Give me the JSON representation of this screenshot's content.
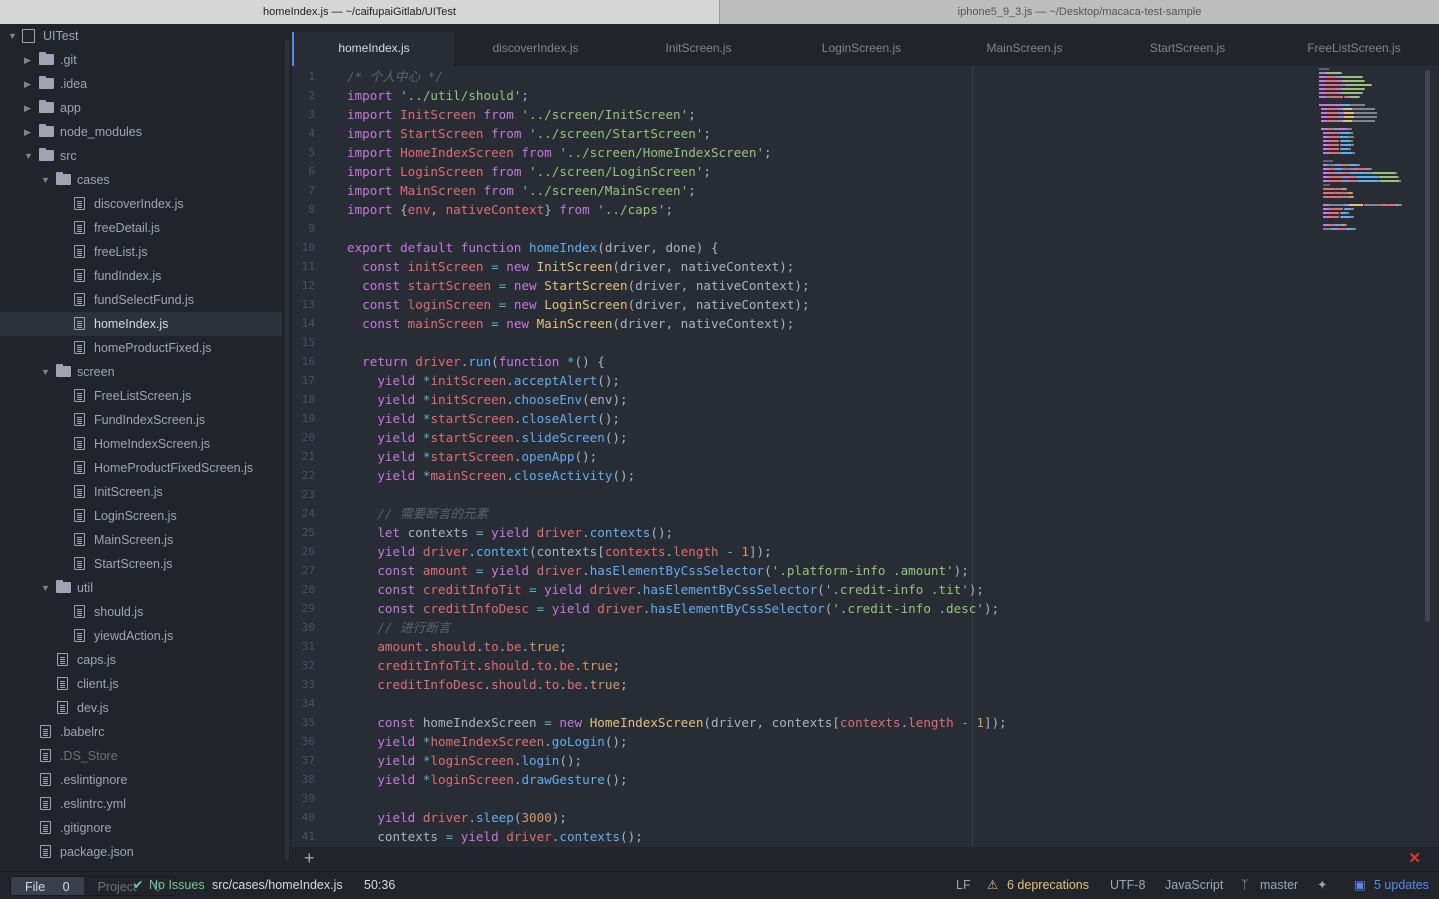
{
  "window_tabs": [
    {
      "title": "homeIndex.js — ~/caifupaiGitlab/UITest"
    },
    {
      "title": "iphone5_9_3.js — ~/Desktop/macaca-test-sample"
    }
  ],
  "tree": {
    "root": "UITest",
    "items": [
      {
        "label": ".git",
        "type": "folder",
        "depth": 1,
        "expanded": false
      },
      {
        "label": ".idea",
        "type": "folder",
        "depth": 1,
        "expanded": false
      },
      {
        "label": "app",
        "type": "folder",
        "depth": 1,
        "expanded": false
      },
      {
        "label": "node_modules",
        "type": "folder",
        "depth": 1,
        "expanded": false
      },
      {
        "label": "src",
        "type": "folder",
        "depth": 1,
        "expanded": true
      },
      {
        "label": "cases",
        "type": "folder",
        "depth": 2,
        "expanded": true
      },
      {
        "label": "discoverIndex.js",
        "type": "file",
        "depth": 3
      },
      {
        "label": "freeDetail.js",
        "type": "file",
        "depth": 3
      },
      {
        "label": "freeList.js",
        "type": "file",
        "depth": 3
      },
      {
        "label": "fundIndex.js",
        "type": "file",
        "depth": 3
      },
      {
        "label": "fundSelectFund.js",
        "type": "file",
        "depth": 3
      },
      {
        "label": "homeIndex.js",
        "type": "file",
        "depth": 3,
        "selected": true
      },
      {
        "label": "homeProductFixed.js",
        "type": "file",
        "depth": 3
      },
      {
        "label": "screen",
        "type": "folder",
        "depth": 2,
        "expanded": true
      },
      {
        "label": "FreeListScreen.js",
        "type": "file",
        "depth": 3
      },
      {
        "label": "FundIndexScreen.js",
        "type": "file",
        "depth": 3
      },
      {
        "label": "HomeIndexScreen.js",
        "type": "file",
        "depth": 3
      },
      {
        "label": "HomeProductFixedScreen.js",
        "type": "file",
        "depth": 3
      },
      {
        "label": "InitScreen.js",
        "type": "file",
        "depth": 3
      },
      {
        "label": "LoginScreen.js",
        "type": "file",
        "depth": 3
      },
      {
        "label": "MainScreen.js",
        "type": "file",
        "depth": 3
      },
      {
        "label": "StartScreen.js",
        "type": "file",
        "depth": 3
      },
      {
        "label": "util",
        "type": "folder",
        "depth": 2,
        "expanded": true
      },
      {
        "label": "should.js",
        "type": "file",
        "depth": 3
      },
      {
        "label": "yiewdAction.js",
        "type": "file",
        "depth": 3
      },
      {
        "label": "caps.js",
        "type": "file",
        "depth": 2
      },
      {
        "label": "client.js",
        "type": "file",
        "depth": 2
      },
      {
        "label": "dev.js",
        "type": "file",
        "depth": 2
      },
      {
        "label": ".babelrc",
        "type": "file",
        "depth": 1
      },
      {
        "label": ".DS_Store",
        "type": "file",
        "depth": 1,
        "dim": true
      },
      {
        "label": ".eslintignore",
        "type": "file",
        "depth": 1
      },
      {
        "label": ".eslintrc.yml",
        "type": "file",
        "depth": 1
      },
      {
        "label": ".gitignore",
        "type": "file",
        "depth": 1
      },
      {
        "label": "package.json",
        "type": "file",
        "depth": 1
      }
    ]
  },
  "editor_tabs": [
    {
      "label": "homeIndex.js",
      "active": true
    },
    {
      "label": "discoverIndex.js"
    },
    {
      "label": "InitScreen.js"
    },
    {
      "label": "LoginScreen.js"
    },
    {
      "label": "MainScreen.js"
    },
    {
      "label": "StartScreen.js"
    },
    {
      "label": "FreeListScreen.js"
    }
  ],
  "code_lines": [
    [
      [
        "c",
        "/* 个人中心 */"
      ]
    ],
    [
      [
        "k",
        "import "
      ],
      [
        "s",
        "'../util/should'"
      ],
      [
        "",
        ";"
      ]
    ],
    [
      [
        "k",
        "import "
      ],
      [
        "v",
        "InitScreen "
      ],
      [
        "k",
        "from "
      ],
      [
        "s",
        "'../screen/InitScreen'"
      ],
      [
        "",
        ";"
      ]
    ],
    [
      [
        "k",
        "import "
      ],
      [
        "v",
        "StartScreen "
      ],
      [
        "k",
        "from "
      ],
      [
        "s",
        "'../screen/StartScreen'"
      ],
      [
        "",
        ";"
      ]
    ],
    [
      [
        "k",
        "import "
      ],
      [
        "v",
        "HomeIndexScreen "
      ],
      [
        "k",
        "from "
      ],
      [
        "s",
        "'../screen/HomeIndexScreen'"
      ],
      [
        "",
        ";"
      ]
    ],
    [
      [
        "k",
        "import "
      ],
      [
        "v",
        "LoginScreen "
      ],
      [
        "k",
        "from "
      ],
      [
        "s",
        "'../screen/LoginScreen'"
      ],
      [
        "",
        ";"
      ]
    ],
    [
      [
        "k",
        "import "
      ],
      [
        "v",
        "MainScreen "
      ],
      [
        "k",
        "from "
      ],
      [
        "s",
        "'../screen/MainScreen'"
      ],
      [
        "",
        ";"
      ]
    ],
    [
      [
        "k",
        "import "
      ],
      [
        "",
        "{"
      ],
      [
        "v",
        "env"
      ],
      [
        "",
        ", "
      ],
      [
        "v",
        "nativeContext"
      ],
      [
        "",
        "} "
      ],
      [
        "k",
        "from "
      ],
      [
        "s",
        "'../caps'"
      ],
      [
        "",
        ";"
      ]
    ],
    [],
    [
      [
        "k",
        "export default function "
      ],
      [
        "f",
        "homeIndex"
      ],
      [
        "",
        "(driver, done) {"
      ]
    ],
    [
      [
        "",
        "  "
      ],
      [
        "k",
        "const "
      ],
      [
        "v",
        "initScreen "
      ],
      [
        "o",
        "= "
      ],
      [
        "k",
        "new "
      ],
      [
        "t",
        "InitScreen"
      ],
      [
        "",
        "(driver, nativeContext);"
      ]
    ],
    [
      [
        "",
        "  "
      ],
      [
        "k",
        "const "
      ],
      [
        "v",
        "startScreen "
      ],
      [
        "o",
        "= "
      ],
      [
        "k",
        "new "
      ],
      [
        "t",
        "StartScreen"
      ],
      [
        "",
        "(driver, nativeContext);"
      ]
    ],
    [
      [
        "",
        "  "
      ],
      [
        "k",
        "const "
      ],
      [
        "v",
        "loginScreen "
      ],
      [
        "o",
        "= "
      ],
      [
        "k",
        "new "
      ],
      [
        "t",
        "LoginScreen"
      ],
      [
        "",
        "(driver, nativeContext);"
      ]
    ],
    [
      [
        "",
        "  "
      ],
      [
        "k",
        "const "
      ],
      [
        "v",
        "mainScreen "
      ],
      [
        "o",
        "= "
      ],
      [
        "k",
        "new "
      ],
      [
        "t",
        "MainScreen"
      ],
      [
        "",
        "(driver, nativeContext);"
      ]
    ],
    [],
    [
      [
        "",
        "  "
      ],
      [
        "k",
        "return "
      ],
      [
        "v",
        "driver"
      ],
      [
        "",
        "."
      ],
      [
        "f",
        "run"
      ],
      [
        "",
        "("
      ],
      [
        "k",
        "function "
      ],
      [
        "o",
        "*"
      ],
      [
        "",
        "() {"
      ]
    ],
    [
      [
        "",
        "    "
      ],
      [
        "k",
        "yield "
      ],
      [
        "o",
        "*"
      ],
      [
        "v",
        "initScreen"
      ],
      [
        "",
        "."
      ],
      [
        "f",
        "acceptAlert"
      ],
      [
        "",
        "();"
      ]
    ],
    [
      [
        "",
        "    "
      ],
      [
        "k",
        "yield "
      ],
      [
        "o",
        "*"
      ],
      [
        "v",
        "initScreen"
      ],
      [
        "",
        "."
      ],
      [
        "f",
        "chooseEnv"
      ],
      [
        "",
        "(env);"
      ]
    ],
    [
      [
        "",
        "    "
      ],
      [
        "k",
        "yield "
      ],
      [
        "o",
        "*"
      ],
      [
        "v",
        "startScreen"
      ],
      [
        "",
        "."
      ],
      [
        "f",
        "closeAlert"
      ],
      [
        "",
        "();"
      ]
    ],
    [
      [
        "",
        "    "
      ],
      [
        "k",
        "yield "
      ],
      [
        "o",
        "*"
      ],
      [
        "v",
        "startScreen"
      ],
      [
        "",
        "."
      ],
      [
        "f",
        "slideScreen"
      ],
      [
        "",
        "();"
      ]
    ],
    [
      [
        "",
        "    "
      ],
      [
        "k",
        "yield "
      ],
      [
        "o",
        "*"
      ],
      [
        "v",
        "startScreen"
      ],
      [
        "",
        "."
      ],
      [
        "f",
        "openApp"
      ],
      [
        "",
        "();"
      ]
    ],
    [
      [
        "",
        "    "
      ],
      [
        "k",
        "yield "
      ],
      [
        "o",
        "*"
      ],
      [
        "v",
        "mainScreen"
      ],
      [
        "",
        "."
      ],
      [
        "f",
        "closeActivity"
      ],
      [
        "",
        "();"
      ]
    ],
    [],
    [
      [
        "",
        "    "
      ],
      [
        "c",
        "// 需要断言的元素"
      ]
    ],
    [
      [
        "",
        "    "
      ],
      [
        "k",
        "let "
      ],
      [
        "",
        "contexts "
      ],
      [
        "o",
        "= "
      ],
      [
        "k",
        "yield "
      ],
      [
        "v",
        "driver"
      ],
      [
        "",
        "."
      ],
      [
        "f",
        "contexts"
      ],
      [
        "",
        "();"
      ]
    ],
    [
      [
        "",
        "    "
      ],
      [
        "k",
        "yield "
      ],
      [
        "v",
        "driver"
      ],
      [
        "",
        "."
      ],
      [
        "f",
        "context"
      ],
      [
        "",
        "(contexts["
      ],
      [
        "v",
        "contexts"
      ],
      [
        "",
        "."
      ],
      [
        "v",
        "length "
      ],
      [
        "o",
        "- "
      ],
      [
        "n",
        "1"
      ],
      [
        "",
        "]);"
      ]
    ],
    [
      [
        "",
        "    "
      ],
      [
        "k",
        "const "
      ],
      [
        "v",
        "amount "
      ],
      [
        "o",
        "= "
      ],
      [
        "k",
        "yield "
      ],
      [
        "v",
        "driver"
      ],
      [
        "",
        "."
      ],
      [
        "f",
        "hasElementByCssSelector"
      ],
      [
        "",
        "("
      ],
      [
        "s",
        "'.platform-info .amount'"
      ],
      [
        "",
        ");"
      ]
    ],
    [
      [
        "",
        "    "
      ],
      [
        "k",
        "const "
      ],
      [
        "v",
        "creditInfoTit "
      ],
      [
        "o",
        "= "
      ],
      [
        "k",
        "yield "
      ],
      [
        "v",
        "driver"
      ],
      [
        "",
        "."
      ],
      [
        "f",
        "hasElementByCssSelector"
      ],
      [
        "",
        "("
      ],
      [
        "s",
        "'.credit-info .tit'"
      ],
      [
        "",
        ");"
      ]
    ],
    [
      [
        "",
        "    "
      ],
      [
        "k",
        "const "
      ],
      [
        "v",
        "creditInfoDesc "
      ],
      [
        "o",
        "= "
      ],
      [
        "k",
        "yield "
      ],
      [
        "v",
        "driver"
      ],
      [
        "",
        "."
      ],
      [
        "f",
        "hasElementByCssSelector"
      ],
      [
        "",
        "("
      ],
      [
        "s",
        "'.credit-info .desc'"
      ],
      [
        "",
        ");"
      ]
    ],
    [
      [
        "",
        "    "
      ],
      [
        "c",
        "// 进行断言"
      ]
    ],
    [
      [
        "",
        "    "
      ],
      [
        "v",
        "amount"
      ],
      [
        "",
        "."
      ],
      [
        "v",
        "should"
      ],
      [
        "",
        "."
      ],
      [
        "v",
        "to"
      ],
      [
        "",
        "."
      ],
      [
        "v",
        "be"
      ],
      [
        "",
        "."
      ],
      [
        "n",
        "true"
      ],
      [
        "",
        ";"
      ]
    ],
    [
      [
        "",
        "    "
      ],
      [
        "v",
        "creditInfoTit"
      ],
      [
        "",
        "."
      ],
      [
        "v",
        "should"
      ],
      [
        "",
        "."
      ],
      [
        "v",
        "to"
      ],
      [
        "",
        "."
      ],
      [
        "v",
        "be"
      ],
      [
        "",
        "."
      ],
      [
        "n",
        "true"
      ],
      [
        "",
        ";"
      ]
    ],
    [
      [
        "",
        "    "
      ],
      [
        "v",
        "creditInfoDesc"
      ],
      [
        "",
        "."
      ],
      [
        "v",
        "should"
      ],
      [
        "",
        "."
      ],
      [
        "v",
        "to"
      ],
      [
        "",
        "."
      ],
      [
        "v",
        "be"
      ],
      [
        "",
        "."
      ],
      [
        "n",
        "true"
      ],
      [
        "",
        ";"
      ]
    ],
    [],
    [
      [
        "",
        "    "
      ],
      [
        "k",
        "const "
      ],
      [
        "",
        "homeIndexScreen "
      ],
      [
        "o",
        "= "
      ],
      [
        "k",
        "new "
      ],
      [
        "t",
        "HomeIndexScreen"
      ],
      [
        "",
        "(driver, contexts["
      ],
      [
        "v",
        "contexts"
      ],
      [
        "",
        "."
      ],
      [
        "v",
        "length "
      ],
      [
        "o",
        "- "
      ],
      [
        "n",
        "1"
      ],
      [
        "",
        "]);"
      ]
    ],
    [
      [
        "",
        "    "
      ],
      [
        "k",
        "yield "
      ],
      [
        "o",
        "*"
      ],
      [
        "v",
        "homeIndexScreen"
      ],
      [
        "",
        "."
      ],
      [
        "f",
        "goLogin"
      ],
      [
        "",
        "();"
      ]
    ],
    [
      [
        "",
        "    "
      ],
      [
        "k",
        "yield "
      ],
      [
        "o",
        "*"
      ],
      [
        "v",
        "loginScreen"
      ],
      [
        "",
        "."
      ],
      [
        "f",
        "login"
      ],
      [
        "",
        "();"
      ]
    ],
    [
      [
        "",
        "    "
      ],
      [
        "k",
        "yield "
      ],
      [
        "o",
        "*"
      ],
      [
        "v",
        "loginScreen"
      ],
      [
        "",
        "."
      ],
      [
        "f",
        "drawGesture"
      ],
      [
        "",
        "();"
      ]
    ],
    [],
    [
      [
        "",
        "    "
      ],
      [
        "k",
        "yield "
      ],
      [
        "v",
        "driver"
      ],
      [
        "",
        "."
      ],
      [
        "f",
        "sleep"
      ],
      [
        "",
        "("
      ],
      [
        "n",
        "3000"
      ],
      [
        "",
        ");"
      ]
    ],
    [
      [
        "",
        "    "
      ],
      [
        "",
        "contexts "
      ],
      [
        "o",
        "= "
      ],
      [
        "k",
        "yield "
      ],
      [
        "v",
        "driver"
      ],
      [
        "",
        "."
      ],
      [
        "f",
        "contexts"
      ],
      [
        "",
        "();"
      ]
    ]
  ],
  "status": {
    "file_tab": "File",
    "file_count": "0",
    "project_tab": "Project",
    "project_count": "0",
    "linter": "No Issues",
    "path": "src/cases/homeIndex.js",
    "cursor": "50:36",
    "line_ending": "LF",
    "deprecations": "6 deprecations",
    "encoding": "UTF-8",
    "grammar": "JavaScript",
    "branch": "master",
    "updates": "5 updates"
  },
  "icons": {
    "linter_ok": "check-icon",
    "warning": "warning-triangle-icon",
    "branch": "git-branch-icon",
    "pin": "pin-icon",
    "updates": "package-icon",
    "add": "plus-icon",
    "close": "close-icon"
  },
  "colors": {
    "keyword": "#c678dd",
    "string": "#98c379",
    "variable": "#e06c75",
    "function": "#61afef",
    "comment": "#5c6370",
    "class": "#e5c07b",
    "number": "#d19a66",
    "operator": "#56b6c2",
    "accent": "#568af2",
    "error": "#e2342b"
  }
}
